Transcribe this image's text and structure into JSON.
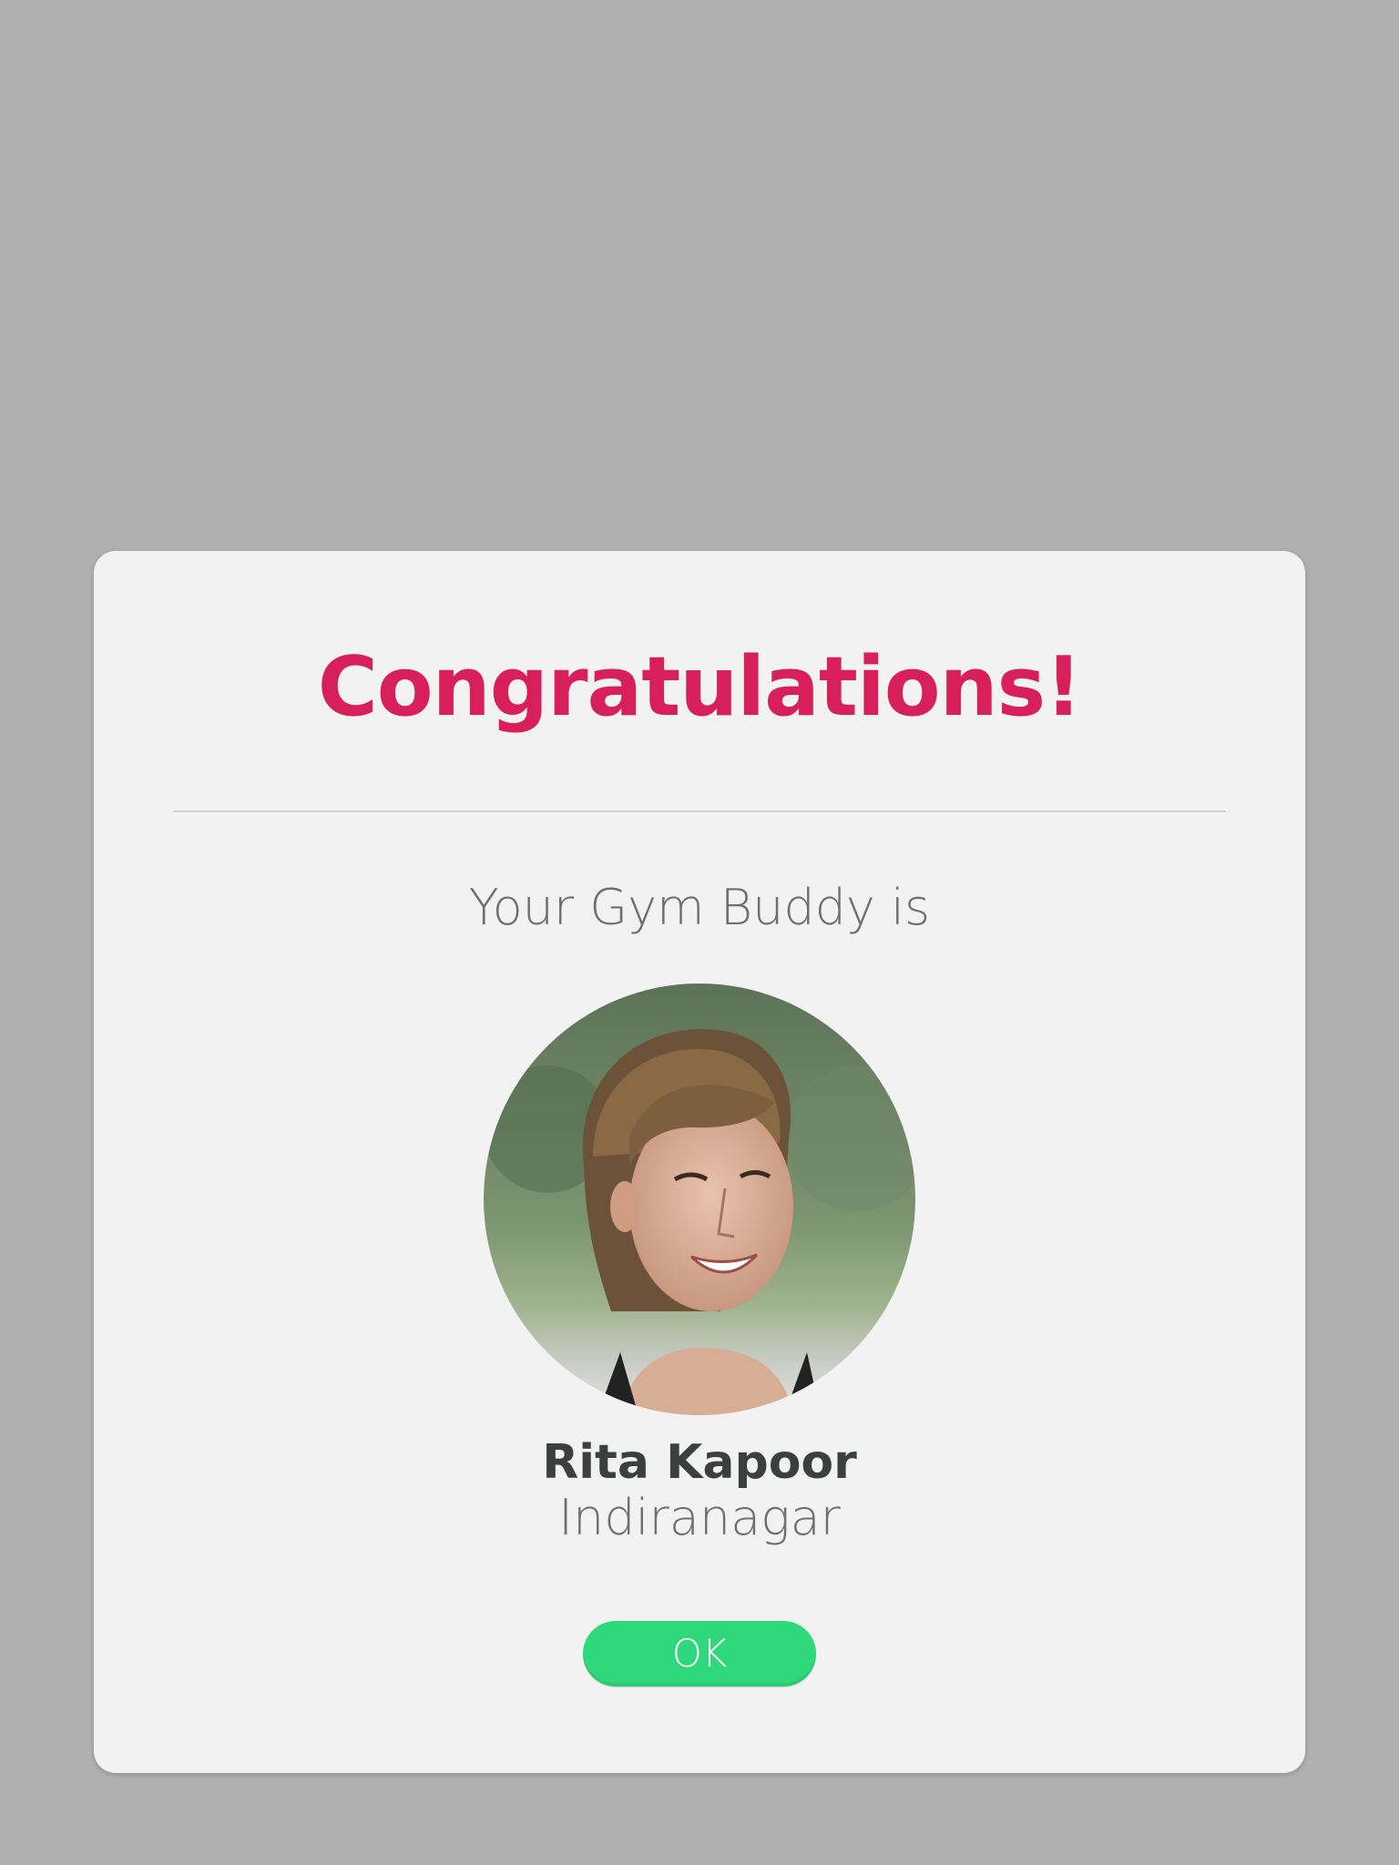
{
  "modal": {
    "title": "Congratulations!",
    "subtitle": "Your Gym Buddy is",
    "buddy": {
      "name": "Rita Kapoor",
      "location": "Indiranagar",
      "avatar_icon": "profile-photo"
    },
    "ok_label": "OK"
  },
  "colors": {
    "overlay": "#b0b0b0",
    "modal_background": "#f1f2f1",
    "title": "#d71f5c",
    "ok_button": "#2fd87a"
  }
}
